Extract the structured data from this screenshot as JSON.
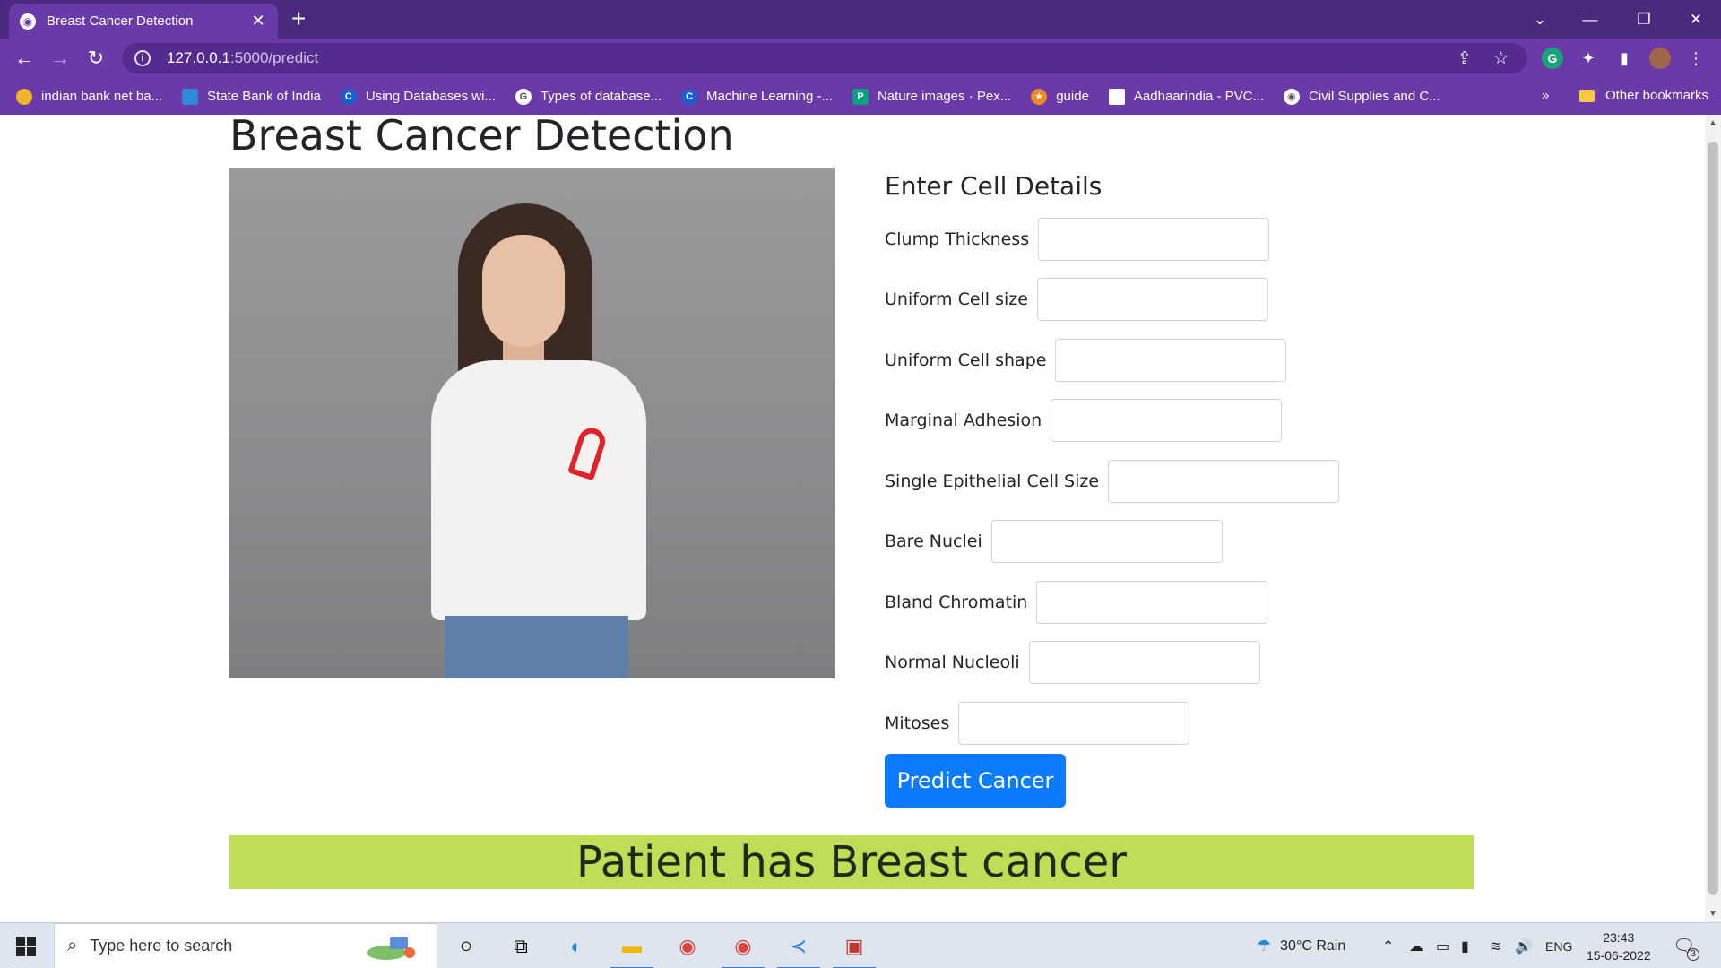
{
  "browser": {
    "tab_title": "Breast Cancer Detection",
    "new_tab": "+",
    "url_host": "127.0.0.1",
    "url_path": ":5000/predict",
    "bookmarks": [
      {
        "label": "indian bank net ba...",
        "icon": "bank-icon",
        "color": "#f0b429"
      },
      {
        "label": "State Bank of India",
        "icon": "sbi-icon",
        "color": "#2e8bd8"
      },
      {
        "label": "Using Databases wi...",
        "icon": "c-icon",
        "color": "#1a5fd1"
      },
      {
        "label": "Types of database...",
        "icon": "g-icon",
        "color": "#ffffff"
      },
      {
        "label": "Machine Learning -...",
        "icon": "c-icon",
        "color": "#1a5fd1"
      },
      {
        "label": "Nature images · Pex...",
        "icon": "pexels-icon",
        "color": "#07a081"
      },
      {
        "label": "guide",
        "icon": "star-icon",
        "color": "#f28b22"
      },
      {
        "label": "Aadhaarindia - PVC...",
        "icon": "doc-icon",
        "color": "#ffffff"
      },
      {
        "label": "Civil Supplies and C...",
        "icon": "globe-icon",
        "color": "#ffffff"
      }
    ],
    "more_bookmarks": "»",
    "other_bookmarks": "Other bookmarks"
  },
  "page": {
    "title": "Breast Cancer Detection",
    "form_title": "Enter Cell Details",
    "fields": [
      {
        "label": "Clump Thickness",
        "name": "clump-thickness"
      },
      {
        "label": "Uniform Cell size",
        "name": "uniform-cell-size"
      },
      {
        "label": "Uniform Cell shape",
        "name": "uniform-cell-shape"
      },
      {
        "label": "Marginal Adhesion",
        "name": "marginal-adhesion"
      },
      {
        "label": "Single Epithelial Cell Size",
        "name": "single-epithelial-cell-size"
      },
      {
        "label": "Bare Nuclei",
        "name": "bare-nuclei"
      },
      {
        "label": "Bland Chromatin",
        "name": "bland-chromatin"
      },
      {
        "label": "Normal Nucleoli",
        "name": "normal-nucleoli"
      },
      {
        "label": "Mitoses",
        "name": "mitoses"
      }
    ],
    "submit_label": "Predict Cancer",
    "result": "Patient has Breast cancer",
    "colors": {
      "accent": "#0d7bfd",
      "result_bg": "#bfdd57",
      "chrome": "#6a3aa8"
    }
  },
  "taskbar": {
    "search_placeholder": "Type here to search",
    "weather": "30°C  Rain",
    "language": "ENG",
    "time": "23:43",
    "date": "15-06-2022",
    "notification_count": "3"
  }
}
